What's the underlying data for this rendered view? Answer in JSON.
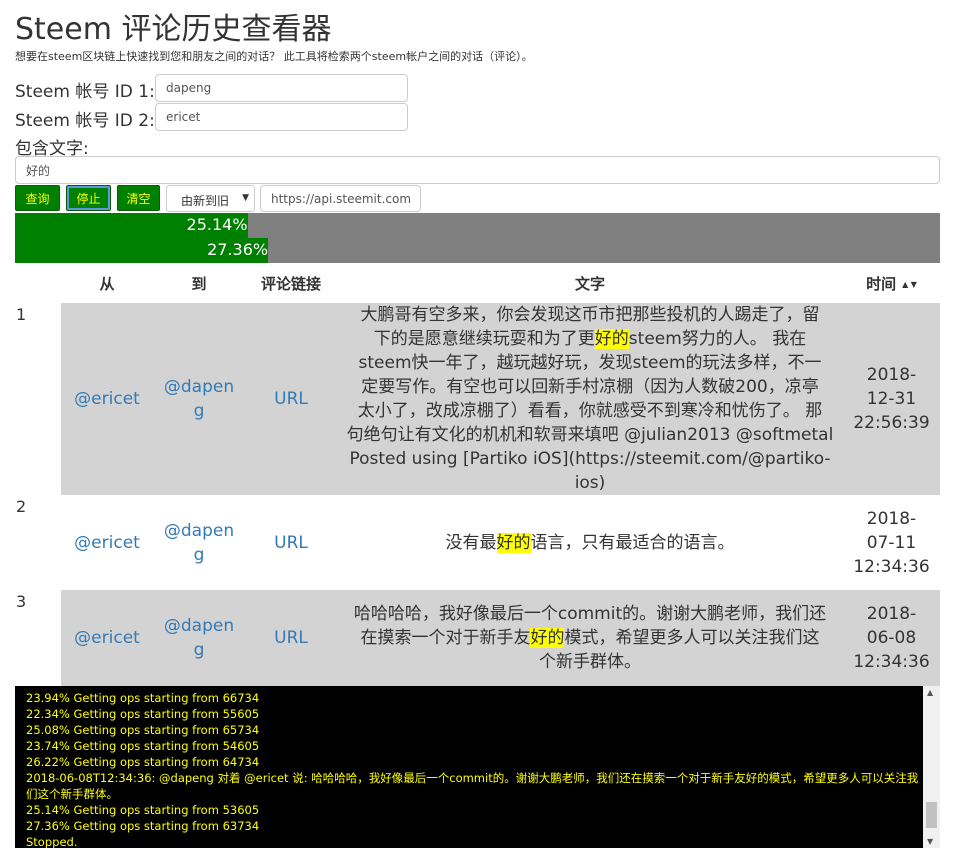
{
  "page": {
    "title": "Steem 评论历史查看器",
    "subtitle": "想要在steem区块链上快速找到您和朋友之间的对话？ 此工具将检索两个steem帐户之间的对话（评论）。"
  },
  "form": {
    "account1_label": "Steem 帐号 ID 1:",
    "account1_value": "dapeng",
    "account2_label": "Steem 帐号 ID 2:",
    "account2_value": "ericet",
    "contains_label": "包含文字:",
    "contains_value": "好的",
    "query_button": "查询",
    "stop_button": "停止",
    "clear_button": "清空",
    "order_select": "由新到旧",
    "api_value": "https://api.steemit.com"
  },
  "progress": [
    {
      "label": "25.14%",
      "value": 25.14
    },
    {
      "label": "27.36%",
      "value": 27.36
    }
  ],
  "colors": {
    "button_bg": "#008000",
    "button_text": "#ffff00",
    "progress_fill": "#008000",
    "progress_track": "#808080",
    "row_shaded": "#d3d3d3",
    "link": "#337ab7",
    "highlight": "#ffff00",
    "console_bg": "#000000",
    "console_text": "#ffff00"
  },
  "table": {
    "headers": {
      "from": "从",
      "to": "到",
      "link": "评论链接",
      "text": "文字",
      "time": "时间"
    },
    "rows": [
      {
        "index": "1",
        "from": "@ericet",
        "to_lines": [
          "@dapen",
          "g"
        ],
        "link": "URL",
        "text_lines": [
          [
            "大鹏哥有空多来，你会发现这币市把那些投机的人踢走了，留"
          ],
          [
            "下的是愿意继续玩耍和为了更",
            "好的",
            "steem努力的人。 我在"
          ],
          [
            "steem快一年了，越玩越好玩，发现steem的玩法多样，不一"
          ],
          [
            "定要写作。有空也可以回新手村凉棚（因为人数破200，凉亭"
          ],
          [
            "太小了，改成凉棚了）看看，你就感受不到寒冷和忧伤了。 那"
          ],
          [
            "句绝句让有文化的机机和软哥来填吧 @julian2013 @softmetal"
          ],
          [
            "Posted using [Partiko iOS](https://steemit.com/@partiko-ios)"
          ]
        ],
        "time_lines": [
          "2018-",
          "12-31",
          "22:56:39"
        ]
      },
      {
        "index": "2",
        "from": "@ericet",
        "to_lines": [
          "@dapen",
          "g"
        ],
        "link": "URL",
        "text_lines": [
          [
            "没有最",
            "好的",
            "语言，只有最适合的语言。"
          ]
        ],
        "time_lines": [
          "2018-",
          "07-11",
          "12:34:36"
        ]
      },
      {
        "index": "3",
        "from": "@ericet",
        "to_lines": [
          "@dapen",
          "g"
        ],
        "link": "URL",
        "text_lines": [
          [
            "哈哈哈哈，我好像最后一个commit的。谢谢大鹏老师，我们还"
          ],
          [
            "在摸索一个对于新手友",
            "好的",
            "模式，希望更多人可以关注我们这"
          ],
          [
            "个新手群体。"
          ]
        ],
        "time_lines": [
          "2018-",
          "06-08",
          "12:34:36"
        ]
      }
    ]
  },
  "console": {
    "lines": [
      "23.94% Getting ops starting from 66734",
      "22.34% Getting ops starting from 55605",
      "25.08% Getting ops starting from 65734",
      "23.74% Getting ops starting from 54605",
      "26.22% Getting ops starting from 64734",
      "2018-06-08T12:34:36: @dapeng 对着 @ericet 说: 哈哈哈哈，我好像最后一个commit的。谢谢大鹏老师，我们还在摸索一个对于新手友好的模式，希望更多人可以关注我们这个新手群体。",
      "25.14% Getting ops starting from 53605",
      "27.36% Getting ops starting from 63734",
      "Stopped."
    ]
  }
}
